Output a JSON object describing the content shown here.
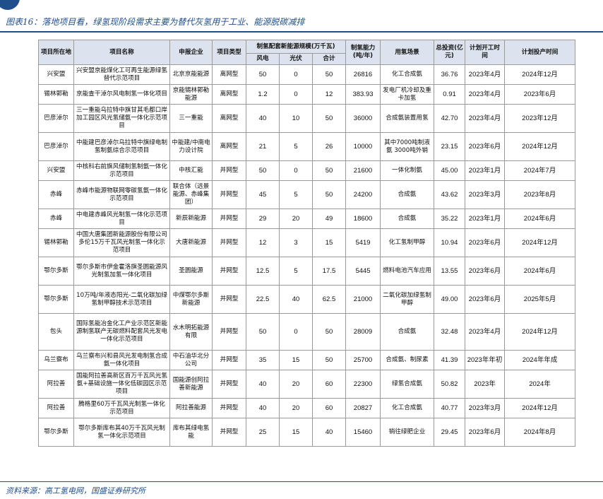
{
  "header": {
    "title": "图表16：落地项目看，绿氢现阶段需求主要为替代灰氢用于工业、能源脱碳减排"
  },
  "table": {
    "headers": {
      "location": "项目所在地",
      "name": "项目名称",
      "company": "申报企业",
      "type": "项目类型",
      "scale": "制氢配套新能源规模(万千瓦)",
      "wind": "风电",
      "pv": "光伏",
      "total": "合计",
      "capacity": "制氢能力(吨/年)",
      "scenario": "用氢场景",
      "investment": "总投资(亿元)",
      "start": "计划开工时间",
      "operation": "计划投产时间"
    },
    "rows": [
      {
        "location": "兴安盟",
        "name": "兴安盟京能煤化工可再生能源绿氢替代示范项目",
        "company": "北京京能能源",
        "type": "离网型",
        "wind": "50",
        "pv": "0",
        "total": "50",
        "capacity": "26816",
        "scenario": "化工合成氨",
        "investment": "36.76",
        "start": "2023年4月",
        "operation": "2024年12月"
      },
      {
        "location": "锡林郭勒",
        "name": "京能查干淖尔风电制氢一体化项目",
        "company": "京能锡林郭勒能源",
        "type": "离网型",
        "wind": "1.2",
        "pv": "0",
        "total": "12",
        "capacity": "383.93",
        "scenario": "发电厂机冷却及重卡加氢",
        "investment": "0.91",
        "start": "2023年4月",
        "operation": "2023年6月"
      },
      {
        "location": "巴彦淖尔",
        "name": "三一重能乌拉特中旗甘其毛都口岸加工园区风光氢储氨一体化示范项目",
        "company": "三一重能",
        "type": "离网型",
        "wind": "40",
        "pv": "10",
        "total": "50",
        "capacity": "36000",
        "scenario": "合成氨装置用氢",
        "investment": "42.70",
        "start": "2023年4月",
        "operation": "2023年12月"
      },
      {
        "location": "巴彦淖尔",
        "name": "中能建巴彦淖尔乌拉特中旗绿电制氢制氨综合示范项目",
        "company": "中能建/中南电力设计院",
        "type": "离网型",
        "wind": "21",
        "pv": "5",
        "total": "26",
        "capacity": "10000",
        "scenario": "其中7000吨制液氨 3000吨外销",
        "investment": "23.15",
        "start": "2023年6月",
        "operation": "2024年12月"
      },
      {
        "location": "兴安盟",
        "name": "中核科右前旗风储制氢制氨一体化示范项目",
        "company": "中核汇能",
        "type": "并网型",
        "wind": "50",
        "pv": "0",
        "total": "50",
        "capacity": "21600",
        "scenario": "一体化制氨",
        "investment": "45.00",
        "start": "2023年1月",
        "operation": "2024年7月"
      },
      {
        "location": "赤峰",
        "name": "赤峰市能源物联网零碳氢氨一体化示范项目",
        "company": "联合体（远景能源、赤峰集团）",
        "type": "并网型",
        "wind": "45",
        "pv": "5",
        "total": "50",
        "capacity": "24200",
        "scenario": "合成氨",
        "investment": "43.62",
        "start": "2023年3月",
        "operation": "2023年8月"
      },
      {
        "location": "赤峰",
        "name": "中电建赤峰风光制氢一体化示范项目",
        "company": "新辰新能源",
        "type": "并网型",
        "wind": "29",
        "pv": "20",
        "total": "49",
        "capacity": "18600",
        "scenario": "合成氨",
        "investment": "35.22",
        "start": "2023年1月",
        "operation": "2024年6月"
      },
      {
        "location": "锡林郭勒",
        "name": "中国大唐集团新能源股份有限公司多伦15万千瓦风光制氢一体化示范项目",
        "company": "大唐新能源",
        "type": "并网型",
        "wind": "12",
        "pv": "3",
        "total": "15",
        "capacity": "5419",
        "scenario": "化工氢制甲醇",
        "investment": "10.94",
        "start": "2023年6月",
        "operation": "2024年12月"
      },
      {
        "location": "鄂尔多斯",
        "name": "鄂尔多斯市伊金霍洛旗圣圆能源风光制氢加氢一体化项目",
        "company": "圣圆能源",
        "type": "并网型",
        "wind": "12.5",
        "pv": "5",
        "total": "17.5",
        "capacity": "5445",
        "scenario": "燃料电池汽车应用",
        "investment": "13.55",
        "start": "2023年6月",
        "operation": "2024年6月"
      },
      {
        "location": "鄂尔多斯",
        "name": "10万吨/年液态阳光-二氧化碳加绿氢制甲醇技术示范项目",
        "company": "中煤鄂尔多斯新能源",
        "type": "并网型",
        "wind": "22.5",
        "pv": "40",
        "total": "62.5",
        "capacity": "21000",
        "scenario": "二氧化碳加绿氢制甲醇",
        "investment": "49.00",
        "start": "2023年6月",
        "operation": "2025年5月"
      },
      {
        "location": "包头",
        "name": "国际氢能冶金化工产业示范区新能源制氢联产无碳燃料配套风光发电一体化示范项目",
        "company": "水木明拓能源有限",
        "type": "并网型",
        "wind": "50",
        "pv": "0",
        "total": "50",
        "capacity": "28009",
        "scenario": "合成氨",
        "investment": "32.48",
        "start": "2023年4月",
        "operation": "2024年12月"
      },
      {
        "location": "乌兰察布",
        "name": "乌兰察布兴和县风光发电制氢合成氨一体化项目",
        "company": "中石油华北分公司",
        "type": "并网型",
        "wind": "35",
        "pv": "15",
        "total": "50",
        "capacity": "25700",
        "scenario": "合成氨、制尿素",
        "investment": "41.39",
        "start": "2023年年初",
        "operation": "2024年年成"
      },
      {
        "location": "阿拉善",
        "name": "国能阿拉善高新区百万千瓦风光氢氨+基础设施一体化低碳园区示范项目",
        "company": "国能源创阿拉善新能源",
        "type": "并网型",
        "wind": "40",
        "pv": "20",
        "total": "60",
        "capacity": "22300",
        "scenario": "绿氢合成氨",
        "investment": "50.82",
        "start": "2023年",
        "operation": "2024年"
      },
      {
        "location": "阿拉善",
        "name": "腾格里60万千瓦风光制氢一体化示范项目",
        "company": "阿拉善能源",
        "type": "并网型",
        "wind": "40",
        "pv": "20",
        "total": "60",
        "capacity": "20827",
        "scenario": "化工合成氨",
        "investment": "40.77",
        "start": "2023年3月",
        "operation": "2024年12月"
      },
      {
        "location": "鄂尔多斯",
        "name": "鄂尔多斯库布其40万千瓦风光制氢一体化示范项目",
        "company": "库布其绿电氢能",
        "type": "并网型",
        "wind": "25",
        "pv": "15",
        "total": "40",
        "capacity": "15460",
        "scenario": "销往绿肥企业",
        "investment": "29.45",
        "start": "2023年6月",
        "operation": "2024年8月"
      }
    ]
  },
  "footer": {
    "source": "资料来源：高工氢电网，国盛证券研究所"
  }
}
